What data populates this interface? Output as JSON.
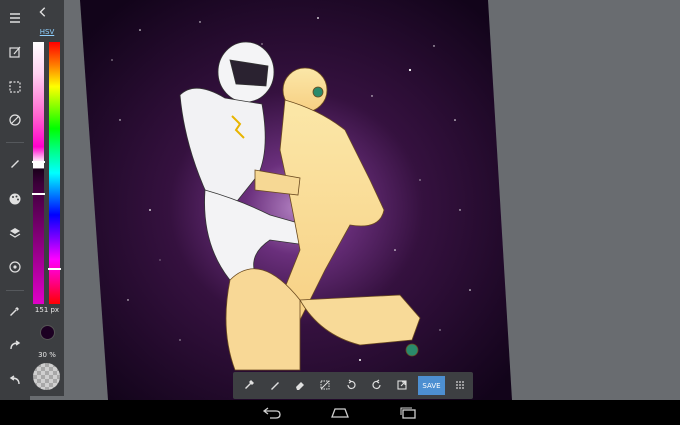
{
  "color_panel": {
    "mode_label": "HSV",
    "size_label": "151 px",
    "opacity_label": "30 %",
    "current_color": "#1c0022"
  },
  "left_toolbar": {
    "items": [
      "menu-icon",
      "new-canvas-icon",
      "select-icon",
      "transform-icon",
      "brush-icon",
      "palette-icon",
      "layers-icon",
      "settings-icon",
      "eyedropper-icon",
      "redo-icon",
      "undo-icon"
    ]
  },
  "bottom_toolbar": {
    "tools": [
      "eyedropper-icon",
      "pencil-icon",
      "eraser-icon",
      "crop-icon",
      "rotate-left-icon",
      "rotate-right-icon",
      "open-icon"
    ],
    "save_label": "SAVE",
    "more_icon": "grid-icon"
  },
  "nav": {
    "items": [
      "back-icon",
      "home-icon",
      "recents-icon"
    ]
  },
  "colors": {
    "toolbar": "#3b3d40",
    "accent": "#4d8fd1",
    "canvas_bg": "#2a0a30"
  }
}
